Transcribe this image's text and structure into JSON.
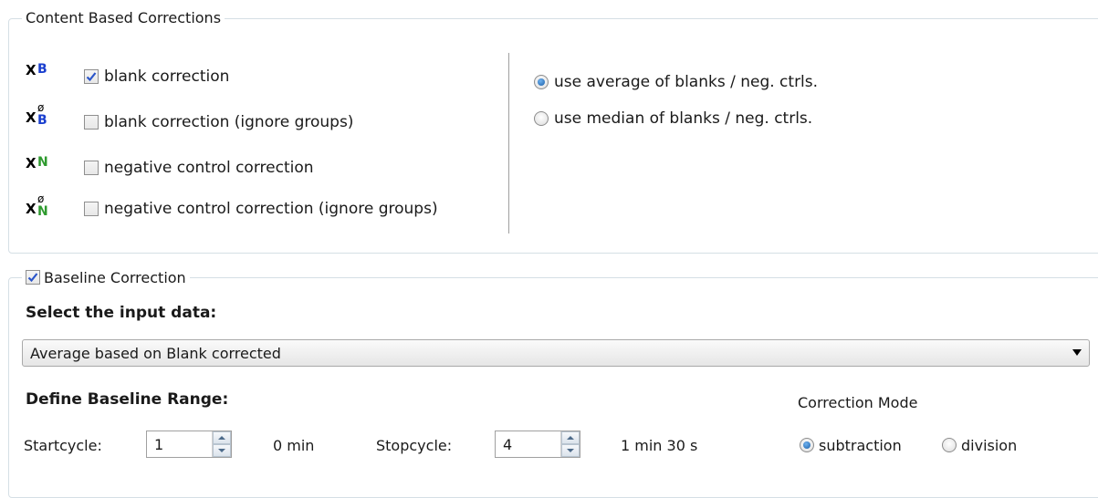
{
  "content_group": {
    "title": "Content Based Corrections",
    "options": [
      {
        "icon_letter": "B",
        "icon_color": "#1a3fcf",
        "ignore_groups": false,
        "label": "blank correction",
        "checked": true
      },
      {
        "icon_letter": "B",
        "icon_color": "#1a3fcf",
        "ignore_groups": true,
        "label": "blank correction (ignore groups)",
        "checked": false
      },
      {
        "icon_letter": "N",
        "icon_color": "#2e9a2e",
        "ignore_groups": false,
        "label": "negative control correction",
        "checked": false
      },
      {
        "icon_letter": "N",
        "icon_color": "#2e9a2e",
        "ignore_groups": true,
        "label": "negative control correction (ignore groups)",
        "checked": false
      }
    ],
    "radios": [
      {
        "label": "use average of blanks / neg. ctrls.",
        "selected": true
      },
      {
        "label": "use median of blanks / neg. ctrls.",
        "selected": false
      }
    ]
  },
  "baseline_group": {
    "title": "Baseline Correction",
    "checked": true,
    "input_heading": "Select the input data:",
    "input_selected": "Average based on Blank corrected",
    "range_heading": "Define Baseline Range:",
    "start_label": "Startcycle:",
    "start_value": "1",
    "start_time": "0 min",
    "stop_label": "Stopcycle:",
    "stop_value": "4",
    "stop_time": "1 min 30 s",
    "mode_heading": "Correction Mode",
    "modes": [
      {
        "label": "subtraction",
        "selected": true
      },
      {
        "label": "division",
        "selected": false
      }
    ]
  },
  "icon_cross": "X",
  "icon_ignore_mark": "ø"
}
